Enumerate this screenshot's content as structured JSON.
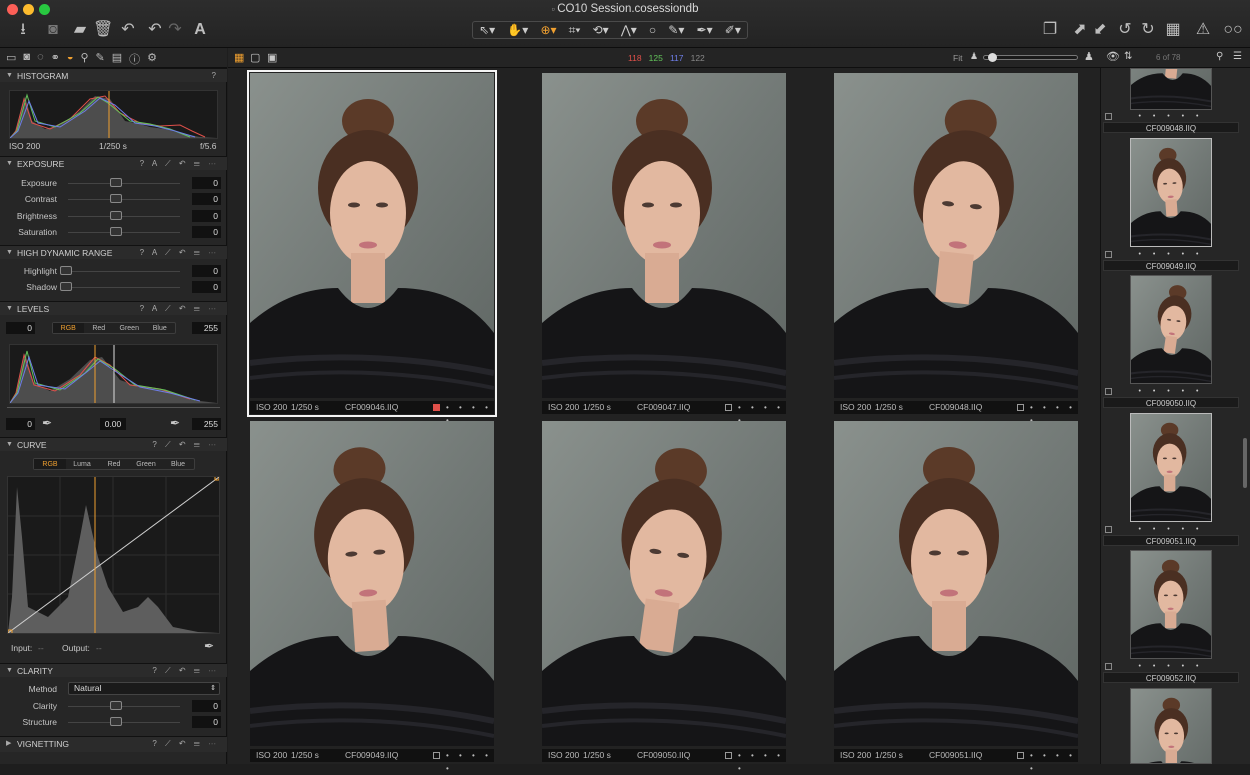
{
  "window": {
    "title": "CO10 Session.cosessiondb"
  },
  "colors": {
    "accent": "#f0a030",
    "red": "#e0504a",
    "green": "#62c45a",
    "blue": "#6e7ee8"
  },
  "toolbar": {
    "left_icons": [
      "import-icon",
      "camera-icon",
      "folder-icon",
      "trash-icon",
      "rotate-icon",
      "undo-icon",
      "redo-icon",
      "text-icon"
    ],
    "center_tools": [
      "select-icon",
      "pan-icon",
      "zoom-icon",
      "crop-icon",
      "rotate-tool-icon",
      "keystone-icon",
      "circle-icon",
      "brush-icon",
      "picker-icon",
      "eraser-icon"
    ],
    "right_icons": [
      "stack-icon",
      "expand-icon",
      "collapse-icon",
      "rotate-left-icon",
      "rotate-right-icon",
      "grid-icon",
      "warning-icon",
      "glasses-icon"
    ]
  },
  "rgb_readout": {
    "r": "118",
    "g": "125",
    "b": "117",
    "l": "122"
  },
  "zoom": {
    "label": "Fit"
  },
  "browser": {
    "count": "6 of 78"
  },
  "histogram": {
    "iso": "ISO 200",
    "shutter": "1/250 s",
    "aperture": "f/5.6",
    "title": "HISTOGRAM",
    "help": "?"
  },
  "exposure": {
    "title": "EXPOSURE",
    "controls": "? A ⟋ ↶ ☰ ⋯",
    "rows": [
      {
        "label": "Exposure",
        "value": "0",
        "pos": 0.5
      },
      {
        "label": "Contrast",
        "value": "0",
        "pos": 0.5
      },
      {
        "label": "Brightness",
        "value": "0",
        "pos": 0.5
      },
      {
        "label": "Saturation",
        "value": "0",
        "pos": 0.5
      }
    ]
  },
  "hdr": {
    "title": "HIGH DYNAMIC RANGE",
    "controls": "? A ⟋ ↶ ☰ ⋯",
    "rows": [
      {
        "label": "Highlight",
        "value": "0",
        "pos": 0
      },
      {
        "label": "Shadow",
        "value": "0",
        "pos": 0
      }
    ]
  },
  "levels": {
    "title": "LEVELS",
    "controls": "? A ⟋ ↶ ☰ ⋯",
    "low": "0",
    "high": "255",
    "mid": "0.00",
    "out_low": "0",
    "out_high": "255",
    "channels": [
      "RGB",
      "Red",
      "Green",
      "Blue"
    ]
  },
  "curve": {
    "title": "CURVE",
    "controls": "? ⟋ ↶ ☰ ⋯",
    "channels": [
      "RGB",
      "Luma",
      "Red",
      "Green",
      "Blue"
    ],
    "input_label": "Input:",
    "input_val": "--",
    "output_label": "Output:",
    "output_val": "--"
  },
  "clarity": {
    "title": "CLARITY",
    "controls": "? ⟋ ↶ ☰ ⋯",
    "method_label": "Method",
    "method_value": "Natural",
    "rows": [
      {
        "label": "Clarity",
        "value": "0",
        "pos": 0.5
      },
      {
        "label": "Structure",
        "value": "0",
        "pos": 0.5
      }
    ]
  },
  "vignetting": {
    "title": "VIGNETTING",
    "controls": "? ⟋ ↶ ☰ ⋯"
  },
  "grid": [
    {
      "iso": "ISO 200",
      "shutter": "1/250 s",
      "file": "CF009046.IIQ",
      "selected": true,
      "tag": "red"
    },
    {
      "iso": "ISO 200",
      "shutter": "1/250 s",
      "file": "CF009047.IIQ",
      "selected": false,
      "tag": "none"
    },
    {
      "iso": "ISO 200",
      "shutter": "1/250 s",
      "file": "CF009048.IIQ",
      "selected": false,
      "tag": "none"
    },
    {
      "iso": "ISO 200",
      "shutter": "1/250 s",
      "file": "CF009049.IIQ",
      "selected": false,
      "tag": "none"
    },
    {
      "iso": "ISO 200",
      "shutter": "1/250 s",
      "file": "CF009050.IIQ",
      "selected": false,
      "tag": "none"
    },
    {
      "iso": "ISO 200",
      "shutter": "1/250 s",
      "file": "CF009051.IIQ",
      "selected": false,
      "tag": "none"
    }
  ],
  "filmstrip": [
    "CF009048.IIQ",
    "CF009049.IIQ",
    "CF009050.IIQ",
    "CF009051.IIQ",
    "CF009052.IIQ"
  ],
  "stars": "• • • • •"
}
